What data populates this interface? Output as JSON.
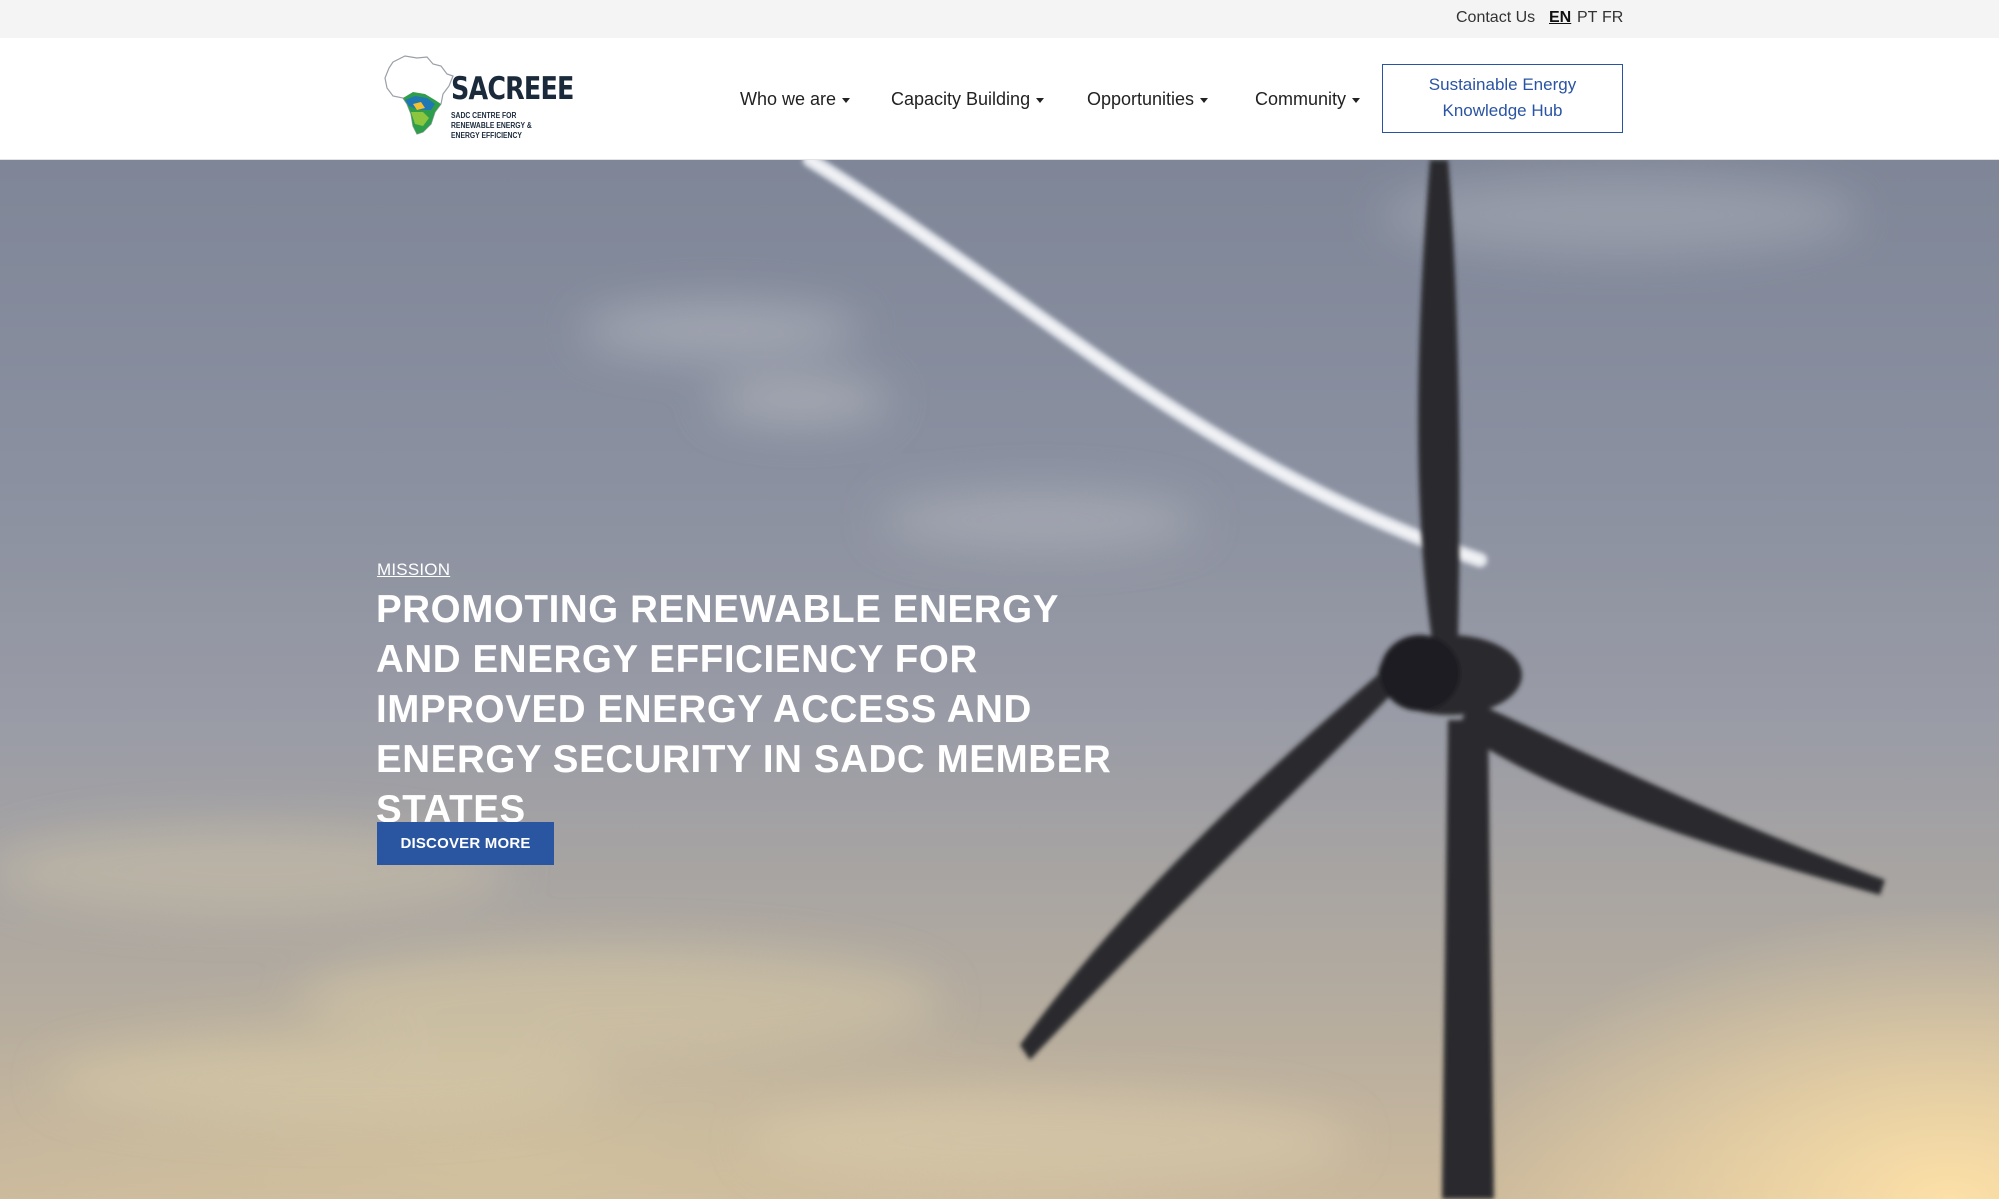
{
  "topbar": {
    "contact_label": "Contact Us",
    "languages": [
      "EN",
      "PT",
      "FR"
    ],
    "active_language": "EN"
  },
  "header": {
    "logo": {
      "name": "SACREEE",
      "tagline": "SADC CENTRE FOR RENEWABLE ENERGY & ENERGY EFFICIENCY"
    },
    "nav": [
      {
        "label": "Who we are"
      },
      {
        "label": "Capacity Building"
      },
      {
        "label": "Opportunities"
      },
      {
        "label": "Community"
      }
    ],
    "hub_button": {
      "line1": "Sustainable Energy",
      "line2": "Knowledge Hub"
    }
  },
  "hero": {
    "label": "MISSION",
    "title": "PROMOTING RENEWABLE ENERGY AND ENERGY EFFICIENCY FOR IMPROVED ENERGY ACCESS AND ENERGY SECURITY IN SADC MEMBER STATES",
    "cta_label": "DISCOVER MORE"
  },
  "colors": {
    "brand_blue": "#2a55a0",
    "topbar_bg": "#f4f4f4",
    "text_dark": "#222222"
  }
}
